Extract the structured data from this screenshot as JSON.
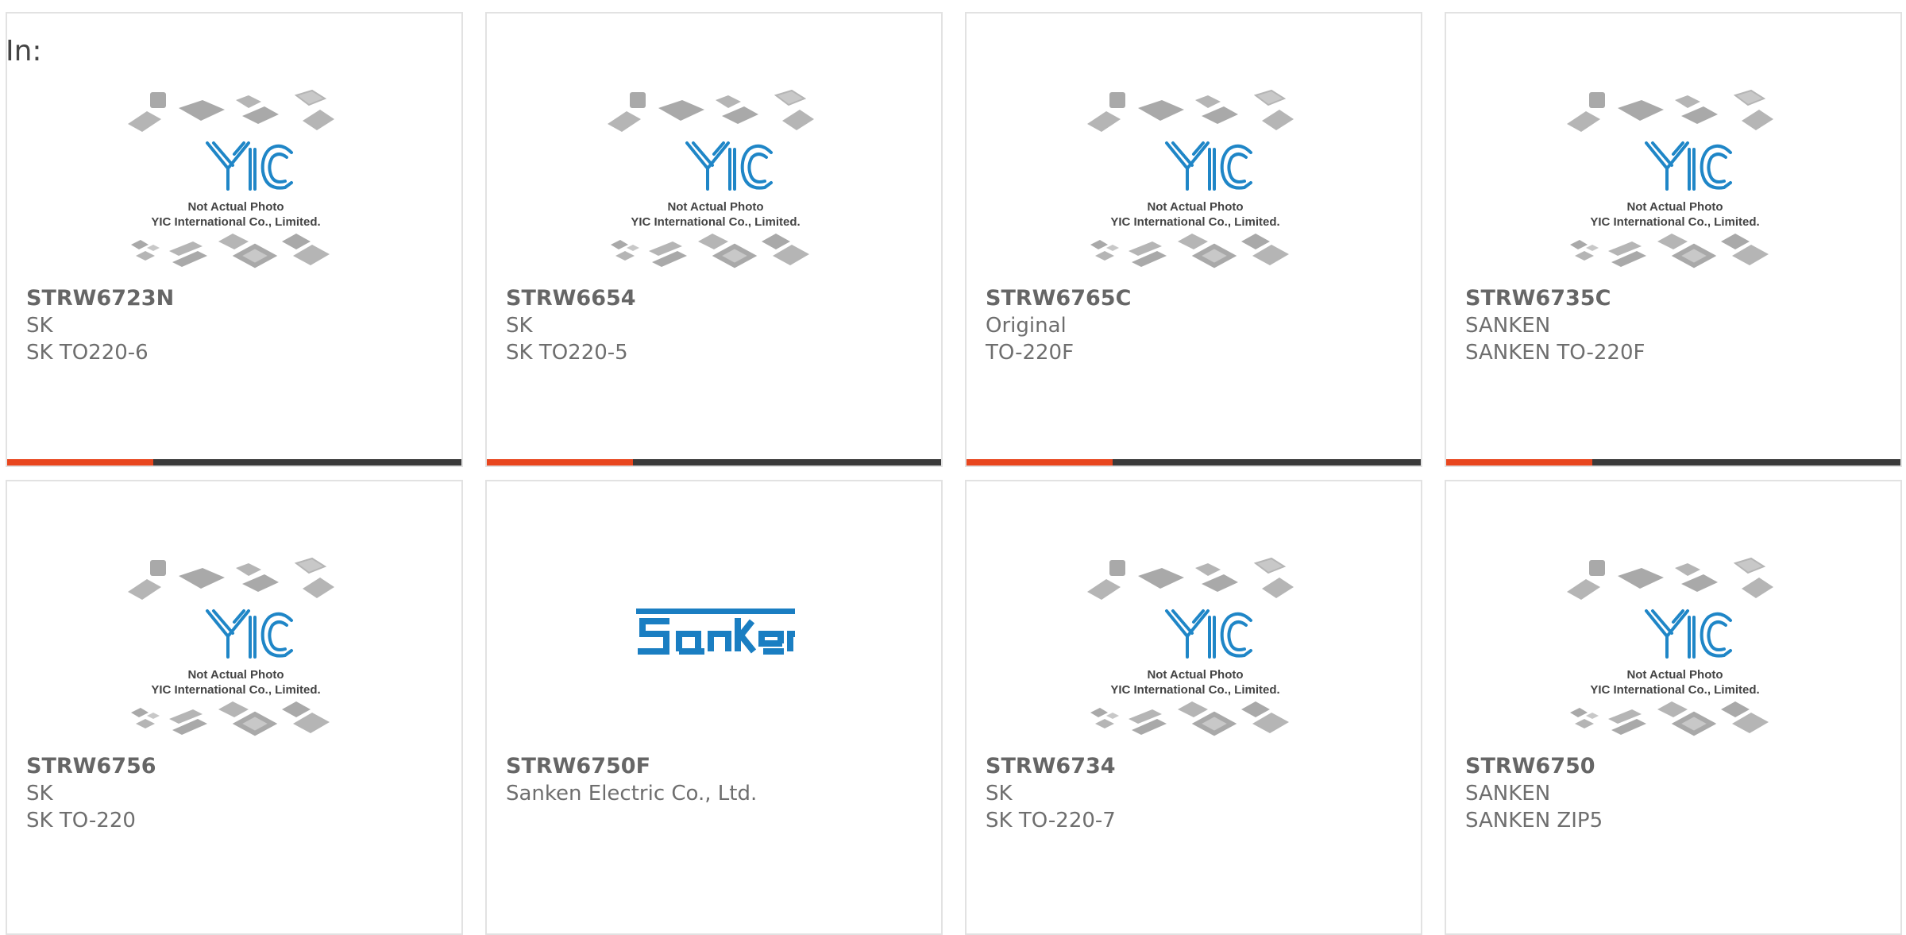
{
  "filter": {
    "label": "In:"
  },
  "colors": {
    "accent": "#e8461e",
    "bar_dark": "#3a3a3a",
    "logo_blue": "#1f86c7",
    "placeholder_gray": "#b5b5b5",
    "sanken_blue": "#1a7ec2"
  },
  "placeholder": {
    "line1": "Not Actual Photo",
    "line2": "YIC International Co., Limited."
  },
  "products": [
    {
      "part": "STRW6723N",
      "maker": "SK",
      "package": "SK TO220-6",
      "image": "yic-placeholder"
    },
    {
      "part": "STRW6654",
      "maker": "SK",
      "package": "SK TO220-5",
      "image": "yic-placeholder"
    },
    {
      "part": "STRW6765C",
      "maker": "Original",
      "package": "TO-220F",
      "image": "yic-placeholder"
    },
    {
      "part": "STRW6735C",
      "maker": "SANKEN",
      "package": "SANKEN TO-220F",
      "image": "yic-placeholder"
    },
    {
      "part": "STRW6756",
      "maker": "SK",
      "package": "SK TO-220",
      "image": "yic-placeholder"
    },
    {
      "part": "STRW6750F",
      "maker": "Sanken Electric Co., Ltd.",
      "package": "",
      "image": "sanken-logo"
    },
    {
      "part": "STRW6734",
      "maker": "SK",
      "package": "SK TO-220-7",
      "image": "yic-placeholder"
    },
    {
      "part": "STRW6750",
      "maker": "SANKEN",
      "package": "SANKEN ZIP5",
      "image": "yic-placeholder"
    }
  ]
}
